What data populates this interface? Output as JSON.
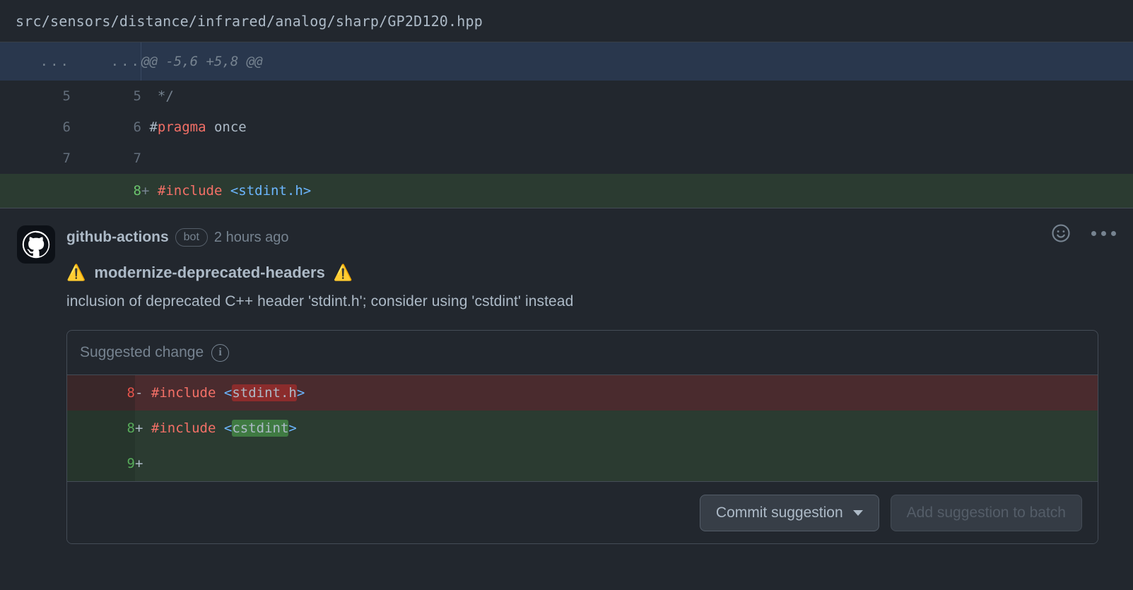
{
  "file": {
    "path": "src/sensors/distance/infrared/analog/sharp/GP2D120.hpp"
  },
  "diff": {
    "hunk": {
      "left_gutter": "...",
      "right_gutter": "...",
      "text": "@@ -5,6 +5,8 @@"
    },
    "rows": [
      {
        "left": "5",
        "right": "5",
        "marker": "",
        "tokens": [
          {
            "text": " */",
            "cls": "tok-cmt"
          }
        ]
      },
      {
        "left": "6",
        "right": "6",
        "marker": "",
        "tokens": [
          {
            "text": "#",
            "cls": "tok-plain"
          },
          {
            "text": "pragma",
            "cls": "tok-pre"
          },
          {
            "text": " once",
            "cls": "tok-plain"
          }
        ]
      },
      {
        "left": "7",
        "right": "7",
        "marker": "",
        "tokens": [
          {
            "text": "",
            "cls": "tok-plain"
          }
        ]
      },
      {
        "left": "",
        "right": "8",
        "marker": "+",
        "type": "add",
        "tokens": [
          {
            "text": "#include ",
            "cls": "tok-pre"
          },
          {
            "text": "<stdint.h>",
            "cls": "tok-str"
          }
        ]
      }
    ]
  },
  "comment": {
    "author": "github-actions",
    "badge": "bot",
    "timestamp": "2 hours ago",
    "warning_glyph": "⚠️",
    "rule_title": "modernize-deprecated-headers",
    "description": "inclusion of deprecated C++ header 'stdint.h'; consider using 'cstdint' instead",
    "reaction_icon": "smiley-icon",
    "menu_icon": "kebab-menu-icon"
  },
  "suggestion": {
    "header_label": "Suggested change",
    "info_glyph": "i",
    "rows": [
      {
        "type": "del",
        "line": "8",
        "marker": "-",
        "tokens": [
          {
            "text": "#include ",
            "cls": "tok-pre"
          },
          {
            "text": "<",
            "cls": "tok-str"
          },
          {
            "text": "stdint.h",
            "cls": "tok-plain",
            "hl": "del"
          },
          {
            "text": ">",
            "cls": "tok-str"
          }
        ]
      },
      {
        "type": "add",
        "line": "8",
        "marker": "+",
        "tokens": [
          {
            "text": "#include ",
            "cls": "tok-pre"
          },
          {
            "text": "<",
            "cls": "tok-str"
          },
          {
            "text": "cstdint",
            "cls": "tok-plain",
            "hl": "add"
          },
          {
            "text": ">",
            "cls": "tok-str"
          }
        ]
      },
      {
        "type": "add",
        "line": "9",
        "marker": "+",
        "tokens": []
      }
    ],
    "commit_button": "Commit suggestion",
    "batch_button": "Add suggestion to batch"
  },
  "colors": {
    "background": "#22272e",
    "hunk": "#29374d",
    "added": "#2b3b31",
    "deleted": "#4a2b2e",
    "highlight_del": "#8b2c2c",
    "highlight_add": "#3f7a42",
    "accent_green": "#57ab5a",
    "accent_red": "#e5534b",
    "text": "#adbac7",
    "muted": "#768390",
    "border": "#444c56"
  }
}
